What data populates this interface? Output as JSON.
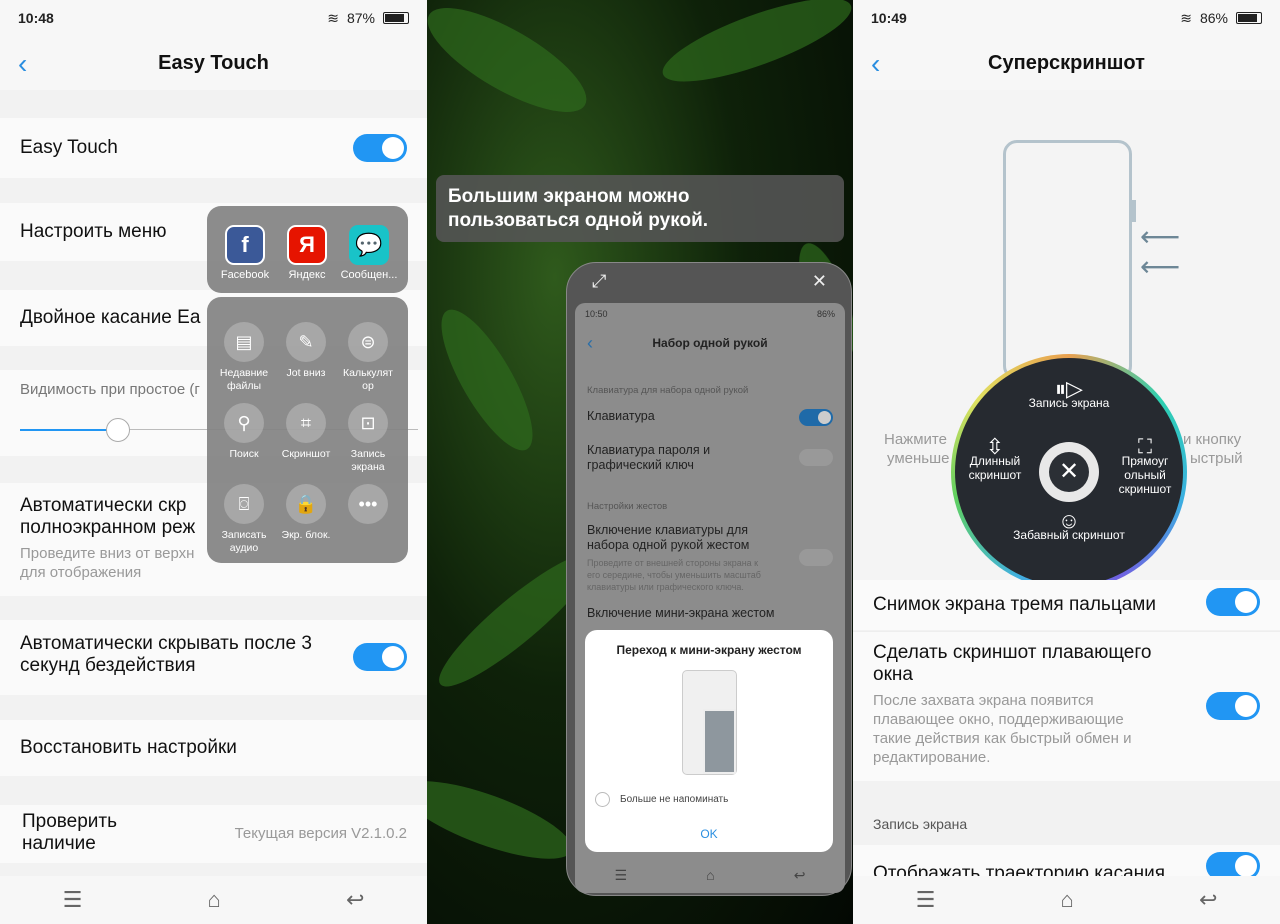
{
  "left": {
    "status": {
      "time": "10:48",
      "battery": "87%",
      "battery_level": 87
    },
    "title": "Easy Touch",
    "easy_touch_label": "Easy Touch",
    "easy_touch_on": true,
    "configure_menu": "Настроить меню",
    "double_tap": "Двойное касание Ea",
    "visibility_label": "Видимость при простое (г",
    "visibility_level": 0.5,
    "auto_hide_full_title": "Автоматически скр\nполноэкранном реж",
    "auto_hide_full_title_l1": "Автоматически скр",
    "auto_hide_full_title_l2": "полноэкранном реж",
    "auto_hide_full_sub_l1": "Проведите вниз от верхн",
    "auto_hide_full_sub_l2": "для отображения",
    "auto_hide_3s_l1": "Автоматически скрывать после 3",
    "auto_hide_3s_l2": "секунд бездействия",
    "auto_hide_3s_on": true,
    "restore": "Восстановить настройки",
    "check_l1": "Проверить",
    "check_l2": "наличие",
    "version": "Текущая версия V2.1.0.2",
    "apps": [
      {
        "label": "Facebook",
        "glyph": "f",
        "color": "#3b5998"
      },
      {
        "label": "Яндекс",
        "glyph": "Я",
        "color": "#e61400"
      },
      {
        "label": "Сообщен...",
        "glyph": "💬",
        "color": "#19c3c8"
      }
    ],
    "tools": [
      {
        "l1": "Недавние",
        "l2": "файлы",
        "glyph": "▤",
        "icon": "file-icon"
      },
      {
        "l1": "Jot вниз",
        "l2": "",
        "glyph": "✎",
        "icon": "note-icon"
      },
      {
        "l1": "Калькулят",
        "l2": "ор",
        "glyph": "⊜",
        "icon": "calculator-icon"
      },
      {
        "l1": "Поиск",
        "l2": "",
        "glyph": "⚲",
        "icon": "search-icon"
      },
      {
        "l1": "Скриншот",
        "l2": "",
        "glyph": "⌗",
        "icon": "crop-icon"
      },
      {
        "l1": "Запись",
        "l2": "экрана",
        "glyph": "⊡",
        "icon": "video-icon"
      },
      {
        "l1": "Записать",
        "l2": "аудио",
        "glyph": "⌼",
        "icon": "tape-icon"
      },
      {
        "l1": "Экр. блок.",
        "l2": "",
        "glyph": "🔒",
        "icon": "lock-icon"
      },
      {
        "l1": "",
        "l2": "",
        "glyph": "•••",
        "icon": "more-icon"
      }
    ]
  },
  "mid": {
    "tooltip_l1": "Большим экраном можно",
    "tooltip_l2": "пользоваться одной рукой.",
    "status": {
      "time": "10:50",
      "battery": "86%"
    },
    "title": "Набор одной рукой",
    "section1": "Клавиатура для набора одной рукой",
    "keyboard": "Клавиатура",
    "keyboard_on": true,
    "password_l1": "Клавиатура пароля и",
    "password_l2": "графический ключ",
    "section2": "Настройки жестов",
    "gesture_l1": "Включение клавиатуры для",
    "gesture_l2": "набора одной рукой жестом",
    "gesture_sub_l1": "Проведите от внешней стороны экрана к",
    "gesture_sub_l2": "его середине, чтобы уменьшить масштаб",
    "gesture_sub_l3": "клавиатуры или графического ключа.",
    "mini": "Включение мини-экрана жестом",
    "dialog_title": "Переход к мини-экрану жестом",
    "dont_remind": "Больше не напоминать",
    "ok": "OK"
  },
  "right": {
    "status": {
      "time": "10:49",
      "battery": "86%",
      "battery_level": 86
    },
    "title": "Суперскриншот",
    "hint_l1": "Нажмите",
    "hint_l1b": "и кнопку",
    "hint_l2": "уменьше",
    "hint_l2b": "ыстрый",
    "wheel": {
      "record": "Запись экрана",
      "long_l1": "Длинный",
      "long_l2": "скриншот",
      "rect_l1": "Прямоуг",
      "rect_l2": "ольный",
      "rect_l3": "скриншот",
      "fun": "Забавный скриншот"
    },
    "three_finger": "Снимок экрана тремя пальцами",
    "three_finger_on": true,
    "float_l1": "Сделать скриншот плавающего",
    "float_l2": "окна",
    "float_sub_l1": "После захвата экрана появится",
    "float_sub_l2": "плавающее окно, поддерживающие",
    "float_sub_l3": "такие действия как быстрый обмен и",
    "float_sub_l4": "редактирование.",
    "float_on": true,
    "section": "Запись экрана",
    "show_touch": "Отображать траекторию касания",
    "show_touch_on": true
  },
  "nav": {
    "menu": "☰",
    "home": "⌂",
    "back": "↩"
  },
  "colors": {
    "accent": "#2196f3",
    "toggle_on": "#2196f3"
  }
}
